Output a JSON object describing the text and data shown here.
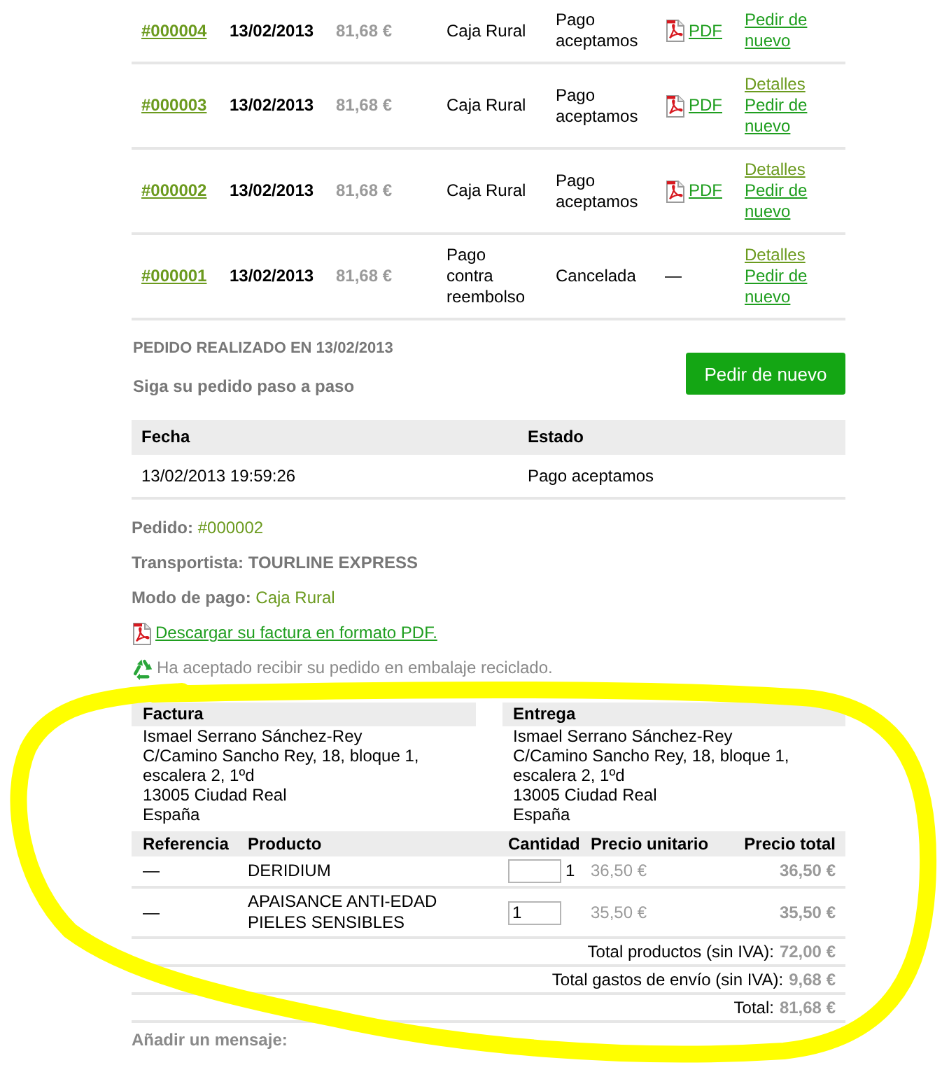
{
  "orders": [
    {
      "reference": "#000004",
      "date": "13/02/2013",
      "total": "81,68 €",
      "payment": "Caja Rural",
      "status": "Pago aceptamos",
      "invoice": {
        "kind": "pdf",
        "label": "PDF"
      },
      "links": [
        {
          "kind": "reorder",
          "label": "Pedir de nuevo"
        }
      ]
    },
    {
      "reference": "#000003",
      "date": "13/02/2013",
      "total": "81,68 €",
      "payment": "Caja Rural",
      "status": "Pago aceptamos",
      "invoice": {
        "kind": "pdf",
        "label": "PDF"
      },
      "links": [
        {
          "kind": "details",
          "label": "Detalles"
        },
        {
          "kind": "reorder",
          "label": "Pedir de nuevo"
        }
      ]
    },
    {
      "reference": "#000002",
      "date": "13/02/2013",
      "total": "81,68 €",
      "payment": "Caja Rural",
      "status": "Pago aceptamos",
      "invoice": {
        "kind": "pdf",
        "label": "PDF"
      },
      "links": [
        {
          "kind": "details",
          "label": "Detalles"
        },
        {
          "kind": "reorder",
          "label": "Pedir de nuevo"
        }
      ]
    },
    {
      "reference": "#000001",
      "date": "13/02/2013",
      "total": "81,68 €",
      "payment": "Pago contra reembolso",
      "status": "Cancelada",
      "invoice": {
        "kind": "none",
        "label": "—"
      },
      "links": [
        {
          "kind": "details",
          "label": "Detalles"
        },
        {
          "kind": "reorder",
          "label": "Pedir de nuevo"
        }
      ]
    }
  ],
  "order_detail": {
    "title": "PEDIDO REALIZADO EN 13/02/2013",
    "subtitle": "Siga su pedido paso a paso",
    "reorder_button": "Pedir de nuevo"
  },
  "history": {
    "columns": [
      "Fecha",
      "Estado"
    ],
    "rows": [
      [
        "13/02/2013 19:59:26",
        "Pago aceptamos"
      ]
    ]
  },
  "info": [
    {
      "kind": "field",
      "label": "Pedido:",
      "value": "#000002",
      "accent": true
    },
    {
      "kind": "field",
      "label": "Transportista:",
      "value": "TOURLINE EXPRESS",
      "accent": false
    },
    {
      "kind": "field",
      "label": "Modo de pago:",
      "value": "Caja Rural",
      "accent": true
    },
    {
      "kind": "download",
      "label": "Descargar su factura en formato PDF."
    },
    {
      "kind": "note",
      "label": "Ha aceptado recibir su pedido en embalaje reciclado."
    }
  ],
  "addresses": [
    {
      "title": "Factura",
      "lines": [
        "Ismael Serrano Sánchez-Rey",
        "C/Camino Sancho Rey, 18, bloque 1, escalera 2, 1ºd",
        "13005 Ciudad Real",
        "España"
      ]
    },
    {
      "title": "Entrega",
      "lines": [
        "Ismael Serrano Sánchez-Rey",
        "C/Camino Sancho Rey, 18, bloque 1, escalera 2, 1ºd",
        "13005 Ciudad Real",
        "España"
      ]
    }
  ],
  "products": {
    "columns": [
      "Referencia",
      "Producto",
      "Cantidad",
      "Precio unitario",
      "Precio total"
    ],
    "rows": [
      {
        "reference": "—",
        "name": "DERIDIUM",
        "quantity": "1",
        "unit_price": "36,50 €",
        "total": "36,50 €"
      },
      {
        "reference": "—",
        "name": "APAISANCE ANTI-EDAD PIELES SENSIBLES",
        "quantity_input": "1",
        "unit_price": "35,50 €",
        "total": "35,50 €"
      }
    ]
  },
  "totals": [
    {
      "label": "Total productos (sin IVA):",
      "value": "72,00 €"
    },
    {
      "label": "Total gastos de envío (sin IVA):",
      "value": "9,68 €"
    },
    {
      "label": "Total:",
      "value": "81,68 €"
    }
  ],
  "message_label": "Añadir un mensaje:"
}
